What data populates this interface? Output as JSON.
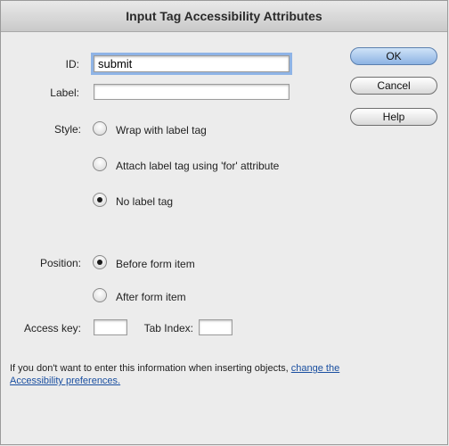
{
  "dialog": {
    "title": "Input Tag Accessibility Attributes"
  },
  "fields": {
    "id_label": "ID:",
    "id_value": "submit",
    "label_label": "Label:",
    "label_value": ""
  },
  "style": {
    "label": "Style:",
    "options": [
      {
        "label": "Wrap with label tag",
        "checked": false
      },
      {
        "label": "Attach label tag using 'for' attribute",
        "checked": false
      },
      {
        "label": "No label tag",
        "checked": true
      }
    ]
  },
  "position": {
    "label": "Position:",
    "options": [
      {
        "label": "Before form item",
        "checked": true
      },
      {
        "label": "After form item",
        "checked": false
      }
    ]
  },
  "access": {
    "access_key_label": "Access key:",
    "access_key_value": "",
    "tab_index_label": "Tab Index:",
    "tab_index_value": ""
  },
  "buttons": {
    "ok": "OK",
    "cancel": "Cancel",
    "help": "Help"
  },
  "note": {
    "text": "If you don't want to enter this information when inserting objects,",
    "link": "change the Accessibility preferences."
  }
}
